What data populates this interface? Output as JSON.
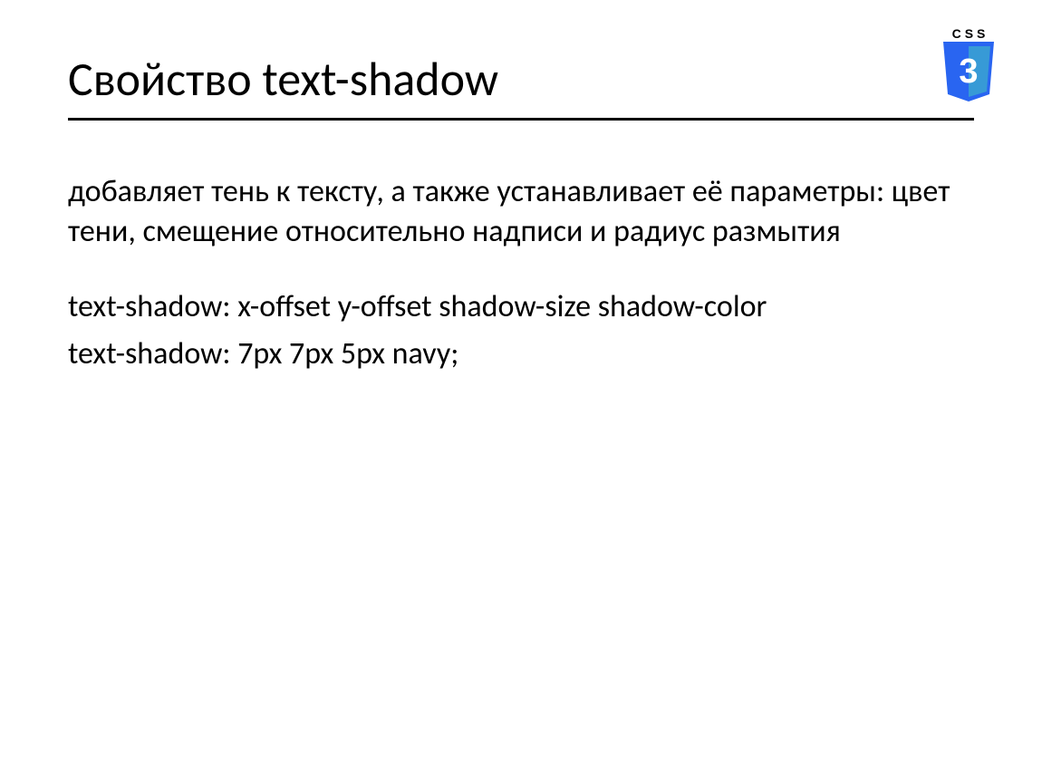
{
  "logo": {
    "text": "CSS",
    "digit": "3"
  },
  "title": "Свойство text-shadow",
  "body": {
    "p1": "добавляет тень к тексту, а также устанавливает её параметры: цвет тени, смещение относительно надписи и радиус размытия",
    "p2": "text-shadow: x-offset y-offset shadow-size shadow-color",
    "p3": "text-shadow: 7px 7px 5px navy;"
  }
}
